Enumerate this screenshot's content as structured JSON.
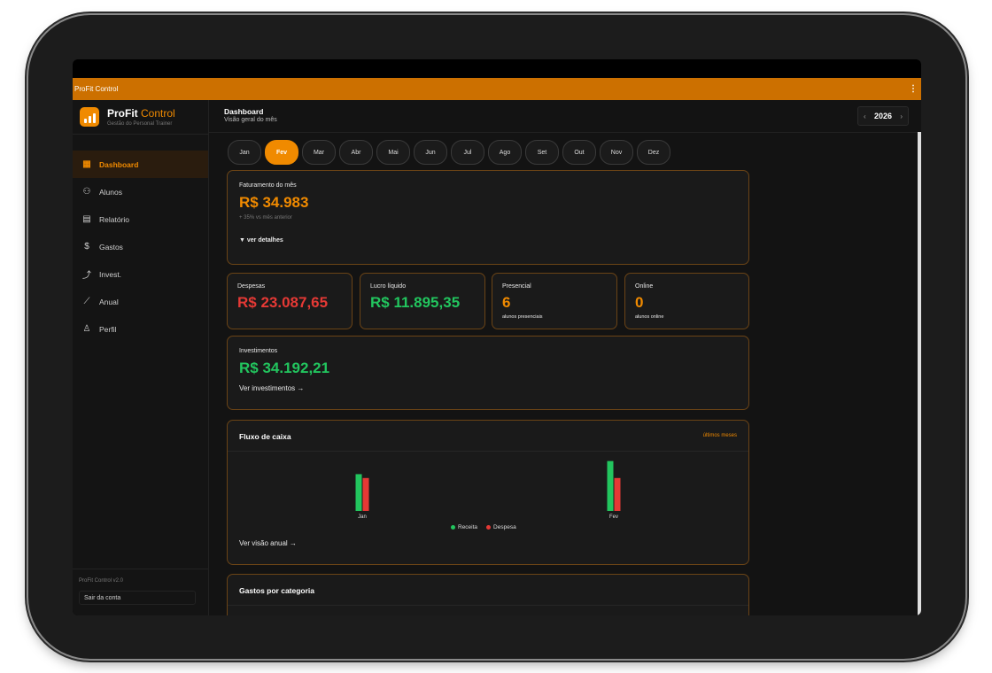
{
  "app_bar": {
    "title": "ProFit Control",
    "menu": "⋮"
  },
  "brand": {
    "name": "ProFit",
    "name_accent": "Control",
    "subtitle": "Gestão do Personal Trainer"
  },
  "nav": [
    {
      "label": "Dashboard",
      "icon": "grid-icon",
      "glyph": "▦"
    },
    {
      "label": "Alunos",
      "icon": "user-plus-icon",
      "glyph": "⚇"
    },
    {
      "label": "Relatório",
      "icon": "document-icon",
      "glyph": "▤"
    },
    {
      "label": "Gastos",
      "icon": "dollar-icon",
      "glyph": "$"
    },
    {
      "label": "Invest.",
      "icon": "trending-up-icon",
      "glyph": "⤴"
    },
    {
      "label": "Anual",
      "icon": "chart-line-icon",
      "glyph": "⟋"
    },
    {
      "label": "Perfil",
      "icon": "user-icon",
      "glyph": "♙"
    }
  ],
  "sidebar_footer": {
    "version": "ProFit Control v2.0",
    "logout": "Sair da conta"
  },
  "header": {
    "title": "Dashboard",
    "subtitle": "Visão geral do mês",
    "year": "2026",
    "prev": "‹",
    "next": "›"
  },
  "months": [
    "Jan",
    "Fev",
    "Mar",
    "Abr",
    "Mai",
    "Jun",
    "Jul",
    "Ago",
    "Set",
    "Out",
    "Nov",
    "Dez"
  ],
  "selected_month": "Fev",
  "faturamento": {
    "label": "Faturamento do mês",
    "value": "R$ 34.983",
    "change": "+ 35% vs mês anterior",
    "details": "▼ ver detalhes"
  },
  "stats": {
    "despesas": {
      "label": "Despesas",
      "value": "R$ 23.087,65"
    },
    "lucro": {
      "label": "Lucro líquido",
      "value": "R$ 11.895,35"
    },
    "presencial": {
      "label": "Presencial",
      "value": "6",
      "sub": "alunos presenciais"
    },
    "online": {
      "label": "Online",
      "value": "0",
      "sub": "alunos online"
    }
  },
  "investimentos": {
    "label": "Investimentos",
    "value": "R$ 34.192,21",
    "link": "Ver investimentos →"
  },
  "fluxo": {
    "title": "Fluxo de caixa",
    "tag": "últimos meses",
    "link": "Ver visão anual →"
  },
  "chart_data": {
    "type": "bar",
    "categories": [
      "Jan",
      "Fev"
    ],
    "series": [
      {
        "name": "Receita",
        "values": [
          25800,
          34983
        ]
      },
      {
        "name": "Despesa",
        "values": [
          23087,
          23087
        ]
      }
    ],
    "ylim": [
      0,
      36000
    ],
    "colors": {
      "Receita": "#22c55e",
      "Despesa": "#e53935"
    },
    "legend": "bottom-center"
  },
  "gastos": {
    "title": "Gastos por categoria"
  }
}
